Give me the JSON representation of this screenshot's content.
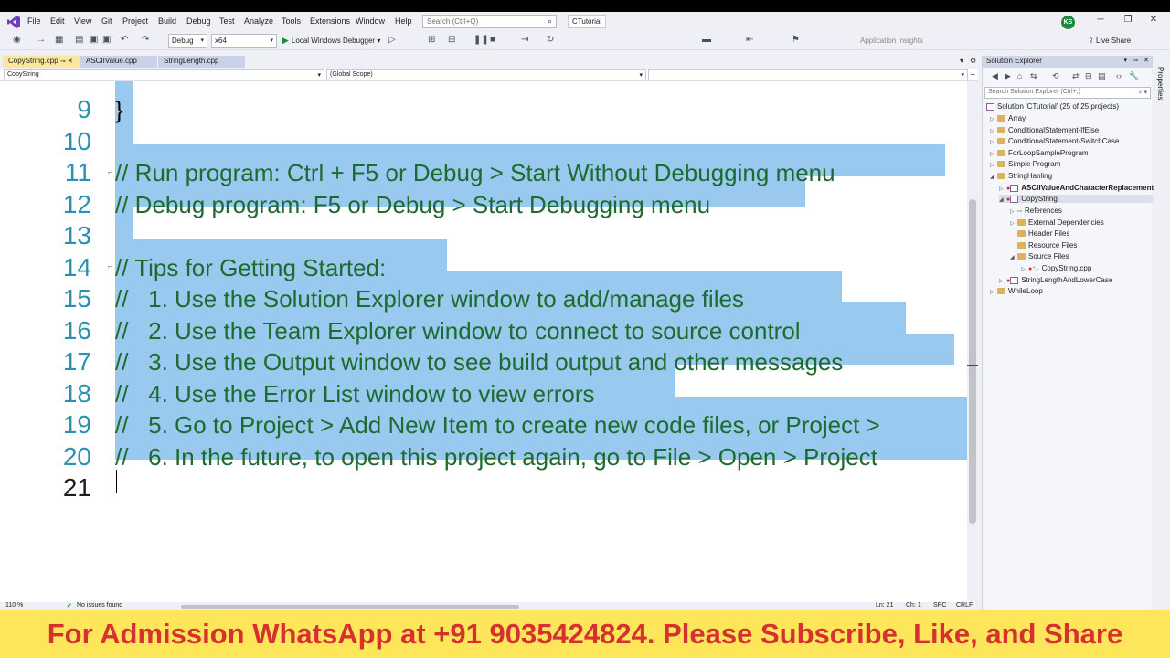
{
  "menu": [
    "File",
    "Edit",
    "View",
    "Git",
    "Project",
    "Build",
    "Debug",
    "Test",
    "Analyze",
    "Tools",
    "Extensions",
    "Window",
    "Help"
  ],
  "search": {
    "placeholder": "Search (Ctrl+Q)"
  },
  "solution_title": "CTutorial",
  "avatar_initials": "KS",
  "toolbar": {
    "config": "Debug",
    "platform": "x64",
    "run_label": "Local Windows Debugger",
    "app_insights": "Application Insights",
    "live_share": "Live Share"
  },
  "tabs": [
    {
      "label": "CopyString.cpp",
      "active": true
    },
    {
      "label": "ASCIIValue.cpp",
      "active": false
    },
    {
      "label": "StringLength.cpp",
      "active": false
    }
  ],
  "nav": {
    "project": "CopyString",
    "scope": "(Global Scope)"
  },
  "code": [
    {
      "n": "9",
      "t": "}"
    },
    {
      "n": "10",
      "t": ""
    },
    {
      "n": "11",
      "t": "// Run program: Ctrl + F5 or Debug > Start Without Debugging menu"
    },
    {
      "n": "12",
      "t": "// Debug program: F5 or Debug > Start Debugging menu"
    },
    {
      "n": "13",
      "t": ""
    },
    {
      "n": "14",
      "t": "// Tips for Getting Started:"
    },
    {
      "n": "15",
      "t": "//   1. Use the Solution Explorer window to add/manage files"
    },
    {
      "n": "16",
      "t": "//   2. Use the Team Explorer window to connect to source control"
    },
    {
      "n": "17",
      "t": "//   3. Use the Output window to see build output and other messages"
    },
    {
      "n": "18",
      "t": "//   4. Use the Error List window to view errors"
    },
    {
      "n": "19",
      "t": "//   5. Go to Project > Add New Item to create new code files, or Project >"
    },
    {
      "n": "20",
      "t": "//   6. In the future, to open this project again, go to File > Open > Project"
    },
    {
      "n": "21",
      "t": ""
    }
  ],
  "status": {
    "zoom": "110 %",
    "issues": "No issues found",
    "ln": "Ln: 21",
    "ch": "Ch: 1",
    "spc": "SPC",
    "crlf": "CRLF"
  },
  "solution_explorer": {
    "title": "Solution Explorer",
    "search_placeholder": "Search Solution Explorer (Ctrl+;)",
    "items": [
      {
        "label": "Solution 'CTutorial' (25 of 25 projects)",
        "indent": 0,
        "kind": "solution"
      },
      {
        "label": "Array",
        "indent": 1,
        "kind": "folder"
      },
      {
        "label": "ConditionalStatement-IfElse",
        "indent": 1,
        "kind": "folder"
      },
      {
        "label": "ConditionalStatement-SwitchCase",
        "indent": 1,
        "kind": "folder"
      },
      {
        "label": "ForLoopSampleProgram",
        "indent": 1,
        "kind": "folder"
      },
      {
        "label": "Simple Program",
        "indent": 1,
        "kind": "folder"
      },
      {
        "label": "StringHanling",
        "indent": 1,
        "kind": "folder"
      },
      {
        "label": "ASCIIValueAndCharacterReplacement",
        "indent": 2,
        "kind": "project"
      },
      {
        "label": "CopyString",
        "indent": 2,
        "kind": "project"
      },
      {
        "label": "References",
        "indent": 3,
        "kind": "ref"
      },
      {
        "label": "External Dependencies",
        "indent": 3,
        "kind": "folder"
      },
      {
        "label": "Header Files",
        "indent": 3,
        "kind": "folder"
      },
      {
        "label": "Resource Files",
        "indent": 3,
        "kind": "folder"
      },
      {
        "label": "Source Files",
        "indent": 3,
        "kind": "folder"
      },
      {
        "label": "CopyString.cpp",
        "indent": 4,
        "kind": "file"
      },
      {
        "label": "StringLengthAndLowerCase",
        "indent": 2,
        "kind": "project"
      },
      {
        "label": "WhileLoop",
        "indent": 1,
        "kind": "folder"
      }
    ]
  },
  "properties_label": "Properties",
  "banner": "For Admission WhatsApp at +91 9035424824. Please Subscribe, Like, and Share",
  "colors": {
    "selection": "#99c9ef",
    "comment": "#1e6b30",
    "line_number": "#2b91af",
    "banner_bg": "#fde65a",
    "banner_text": "#d63030"
  }
}
